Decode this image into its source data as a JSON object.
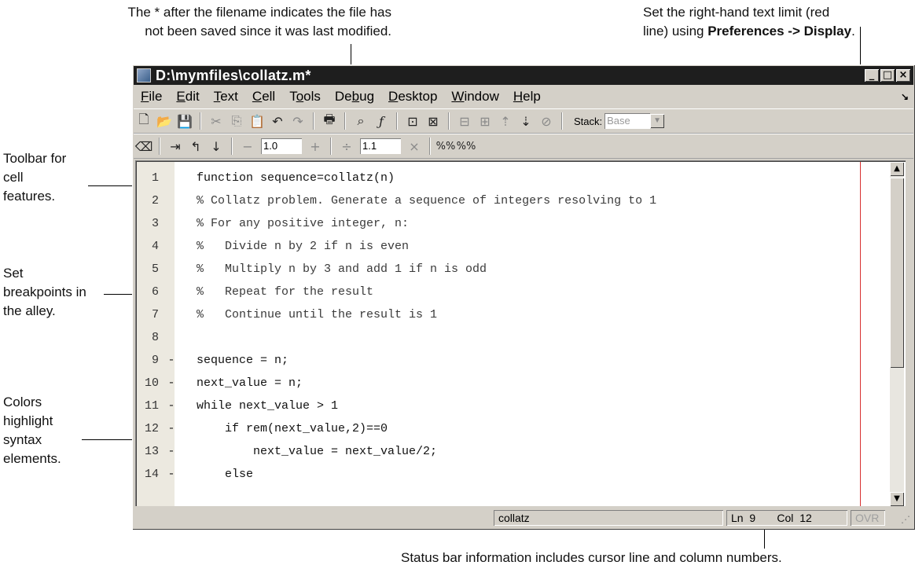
{
  "callouts": {
    "top_left_line1": "The * after the filename indicates the file has",
    "top_left_line2": "not been saved since it was last modified.",
    "top_right_line1": "Set the right-hand text limit (red",
    "top_right_line2_pre": "line) using ",
    "top_right_line2_bold": "Preferences -> Display",
    "top_right_line2_post": ".",
    "toolbar_line1": "Toolbar for",
    "toolbar_line2": "cell",
    "toolbar_line3": "features.",
    "breakpoints_line1": "Set",
    "breakpoints_line2": "breakpoints in",
    "breakpoints_line3": "the alley.",
    "colors_line1": "Colors",
    "colors_line2": "highlight",
    "colors_line3": "syntax",
    "colors_line4": "elements.",
    "status_line": "Status bar information includes cursor line and column numbers."
  },
  "window": {
    "title": "D:\\mymfiles\\collatz.m*",
    "minimize": "_",
    "maximize": "□",
    "close": "×"
  },
  "menu": [
    {
      "pre": "",
      "u": "F",
      "post": "ile"
    },
    {
      "pre": "",
      "u": "E",
      "post": "dit"
    },
    {
      "pre": "",
      "u": "T",
      "post": "ext"
    },
    {
      "pre": "",
      "u": "C",
      "post": "ell"
    },
    {
      "pre": "T",
      "u": "o",
      "post": "ols"
    },
    {
      "pre": "De",
      "u": "b",
      "post": "ug"
    },
    {
      "pre": "",
      "u": "D",
      "post": "esktop"
    },
    {
      "pre": "",
      "u": "W",
      "post": "indow"
    },
    {
      "pre": "",
      "u": "H",
      "post": "elp"
    }
  ],
  "toolbar": {
    "stack_label": "Stack:",
    "stack_value": "Base",
    "cell_decrement_value": "1.0",
    "cell_divide_value": "1.1"
  },
  "editor": {
    "lines": [
      {
        "n": "1",
        "bp": "",
        "code": "function sequence=collatz(n)",
        "comment": false
      },
      {
        "n": "2",
        "bp": "",
        "code": "% Collatz problem. Generate a sequence of integers resolving to 1",
        "comment": true
      },
      {
        "n": "3",
        "bp": "",
        "code": "% For any positive integer, n:",
        "comment": true
      },
      {
        "n": "4",
        "bp": "",
        "code": "%   Divide n by 2 if n is even",
        "comment": true
      },
      {
        "n": "5",
        "bp": "",
        "code": "%   Multiply n by 3 and add 1 if n is odd",
        "comment": true
      },
      {
        "n": "6",
        "bp": "",
        "code": "%   Repeat for the result",
        "comment": true
      },
      {
        "n": "7",
        "bp": "",
        "code": "%   Continue until the result is 1",
        "comment": true
      },
      {
        "n": "8",
        "bp": "",
        "code": "",
        "comment": false
      },
      {
        "n": "9",
        "bp": "-",
        "code": "sequence = n;",
        "comment": false
      },
      {
        "n": "10",
        "bp": "-",
        "code": "next_value = n;",
        "comment": false
      },
      {
        "n": "11",
        "bp": "-",
        "code": "while next_value > 1",
        "comment": false
      },
      {
        "n": "12",
        "bp": "-",
        "code": "    if rem(next_value,2)==0",
        "comment": false
      },
      {
        "n": "13",
        "bp": "-",
        "code": "        next_value = next_value/2;",
        "comment": false
      },
      {
        "n": "14",
        "bp": "-",
        "code": "    else",
        "comment": false
      }
    ]
  },
  "status": {
    "function_name": "collatz",
    "ln_label": "Ln",
    "ln_value": "9",
    "col_label": "Col",
    "col_value": "12",
    "ovr": "OVR"
  }
}
